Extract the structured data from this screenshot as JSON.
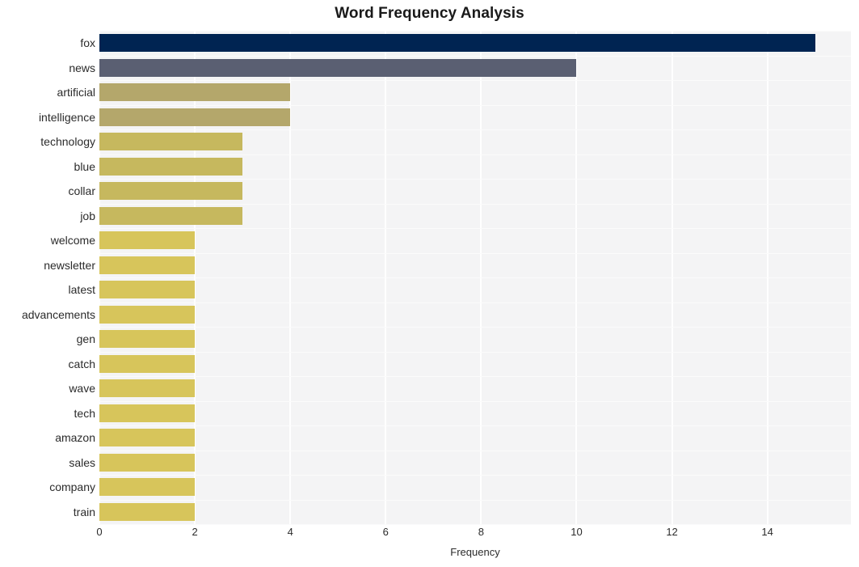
{
  "chart_data": {
    "type": "bar",
    "orientation": "horizontal",
    "title": "Word Frequency Analysis",
    "xlabel": "Frequency",
    "ylabel": "",
    "categories": [
      "fox",
      "news",
      "artificial",
      "intelligence",
      "technology",
      "blue",
      "collar",
      "job",
      "welcome",
      "newsletter",
      "latest",
      "advancements",
      "gen",
      "catch",
      "wave",
      "tech",
      "amazon",
      "sales",
      "company",
      "train"
    ],
    "values": [
      15,
      10,
      4,
      4,
      3,
      3,
      3,
      3,
      2,
      2,
      2,
      2,
      2,
      2,
      2,
      2,
      2,
      2,
      2,
      2
    ],
    "bar_colors": [
      "#002452",
      "#5a5f72",
      "#b4a76b",
      "#b4a76b",
      "#c6b85e",
      "#c6b85e",
      "#c6b85e",
      "#c6b85e",
      "#d7c55b",
      "#d7c55b",
      "#d7c55b",
      "#d7c55b",
      "#d7c55b",
      "#d7c55b",
      "#d7c55b",
      "#d7c55b",
      "#d7c55b",
      "#d7c55b",
      "#d7c55b",
      "#d7c55b"
    ],
    "xticks": [
      0,
      2,
      4,
      6,
      8,
      10,
      12,
      14
    ],
    "xtick_labels": [
      "0",
      "2",
      "4",
      "6",
      "8",
      "10",
      "12",
      "14"
    ],
    "xlim": [
      0,
      15.75
    ],
    "grid": true,
    "grid_color": "#ffffff",
    "legend": "none",
    "plot_background": "#f4f4f5",
    "figure_background": "#ffffff"
  }
}
